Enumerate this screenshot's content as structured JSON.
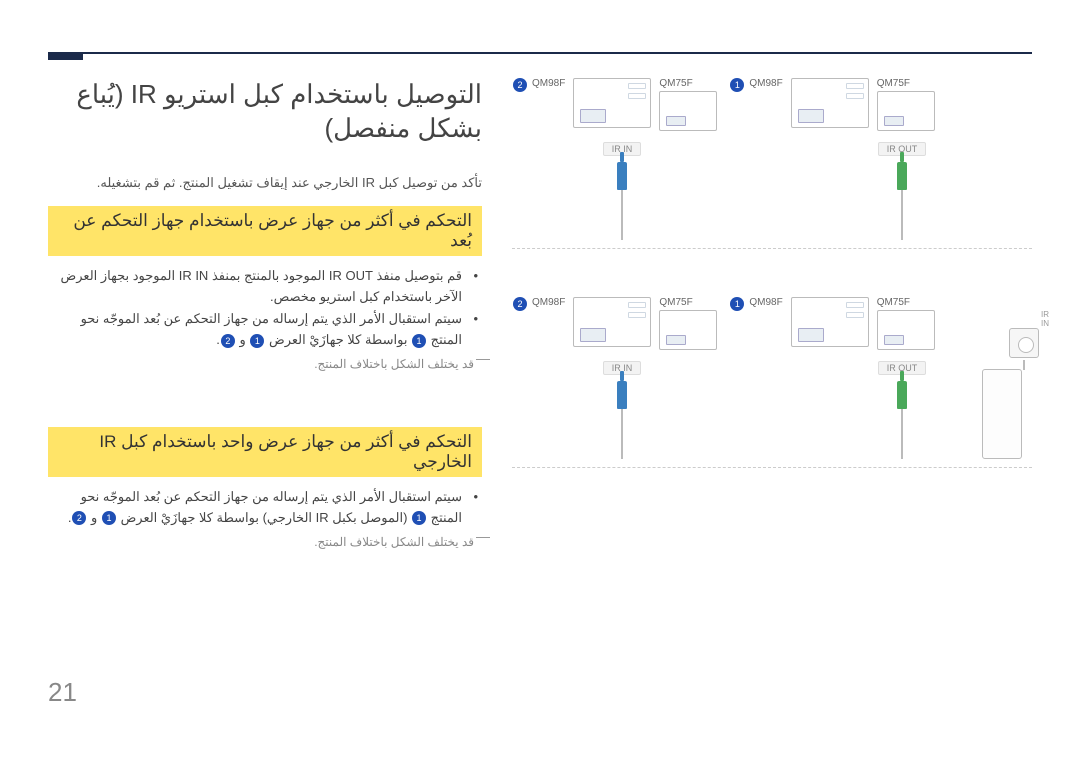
{
  "page_number": "21",
  "title": "التوصيل باستخدام كبل استريو IR (يُباع بشكل منفصل)",
  "intro_note": "تأكد من توصيل كبل IR الخارجي عند إيقاف تشغيل المنتج. ثم قم بتشغيله.",
  "section1": {
    "heading": "التحكم في أكثر من جهاز عرض باستخدام جهاز التحكم عن بُعد",
    "bullets": [
      "قم بتوصيل منفذ IR OUT الموجود بالمنتج بمنفذ IR IN الموجود بجهاز العرض الآخر باستخدام كبل استريو مخصص.",
      "سيتم استقبال الأمر الذي يتم إرساله من جهاز التحكم عن بُعد الموجّه نحو المنتج 1 بواسطة كلا جهازَيْ العرض 1 و 2."
    ],
    "footnote": "قد يختلف الشكل باختلاف المنتج."
  },
  "section2": {
    "heading": "التحكم في أكثر من جهاز عرض واحد باستخدام كبل IR الخارجي",
    "bullets": [
      "سيتم استقبال الأمر الذي يتم إرساله من جهاز التحكم عن بُعد الموجّه نحو المنتج 1 (الموصل بكبل IR الخارجي) بواسطة كلا جهازَيْ العرض 1 و 2."
    ],
    "footnote": "قد يختلف الشكل باختلاف المنتج."
  },
  "diagram": {
    "model_a": "QM98F",
    "model_b": "QM75F",
    "badge_one": "1",
    "badge_two": "2",
    "ir_in": "IR IN",
    "ir_out": "IR OUT"
  }
}
